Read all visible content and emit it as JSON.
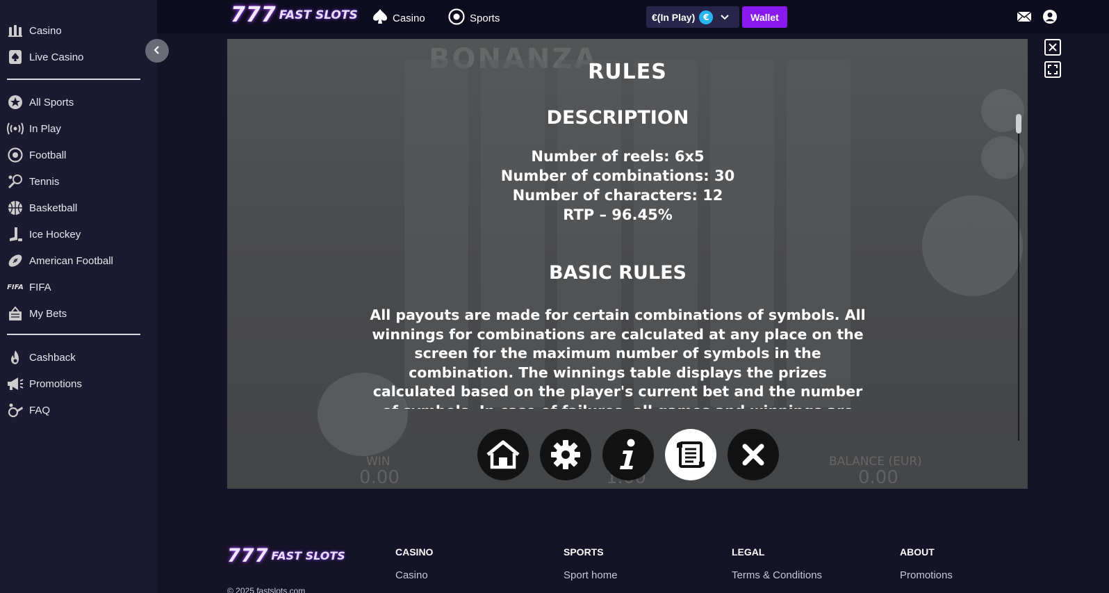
{
  "sidebar": {
    "items": [
      {
        "label": "Casino",
        "icon": "casino-icon"
      },
      {
        "label": "Live Casino",
        "icon": "spade-icon"
      },
      {
        "label": "All Sports",
        "icon": "star-icon"
      },
      {
        "label": "In Play",
        "icon": "broadcast-icon"
      },
      {
        "label": "Football",
        "icon": "football-icon"
      },
      {
        "label": "Tennis",
        "icon": "tennis-icon"
      },
      {
        "label": "Basketball",
        "icon": "basketball-icon"
      },
      {
        "label": "Ice Hockey",
        "icon": "hockey-icon"
      },
      {
        "label": "American Football",
        "icon": "american-football-icon"
      },
      {
        "label": "FIFA",
        "icon": "fifa-icon"
      },
      {
        "label": "My Bets",
        "icon": "bets-icon"
      },
      {
        "label": "Cashback",
        "icon": "flame-icon"
      },
      {
        "label": "Promotions",
        "icon": "megaphone-icon"
      },
      {
        "label": "FAQ",
        "icon": "faq-icon"
      }
    ],
    "fifa_glyph": "FIFA"
  },
  "header": {
    "logo_777": "777",
    "logo_text": "FAST SLOTS",
    "nav": [
      {
        "label": "Casino",
        "icon": "spade-icon"
      },
      {
        "label": "Sports",
        "icon": "football-icon"
      }
    ],
    "balance_label": "€(In Play)",
    "currency_symbol": "€",
    "wallet_label": "Wallet"
  },
  "game": {
    "ghost_logo": "BONANZA",
    "rules_title": "RULES",
    "description_title": "DESCRIPTION",
    "description_lines": [
      "Number of reels: 6x5",
      "Number of combinations: 30",
      "Number of characters: 12",
      "RTP – 96.45%"
    ],
    "basic_rules_title": "BASIC RULES",
    "basic_rules_text": "All payouts are made for certain combinations of symbols. All winnings for combinations are calculated at any place on the screen for the maximum number of symbols in the combination. The winnings table displays the prizes calculated based on the player's current bet and the number of symbols. In case of failures, all games and winnings are canceled.",
    "controls": [
      {
        "name": "home-button",
        "icon": "home-icon",
        "active": false
      },
      {
        "name": "settings-button",
        "icon": "gear-icon",
        "active": false
      },
      {
        "name": "info-button",
        "icon": "info-icon",
        "active": false
      },
      {
        "name": "rules-button",
        "icon": "scroll-icon",
        "active": true
      },
      {
        "name": "close-button",
        "icon": "close-icon",
        "active": false
      }
    ],
    "ghost_win_label": "WIN",
    "ghost_win_value": "0.00",
    "ghost_bet_value": "1.00",
    "ghost_balance_label": "BALANCE (EUR)",
    "ghost_balance_value": "0.00"
  },
  "footer": {
    "columns": [
      {
        "head": "CASINO",
        "link": "Casino"
      },
      {
        "head": "SPORTS",
        "link": "Sport home"
      },
      {
        "head": "LEGAL",
        "link": "Terms & Conditions"
      },
      {
        "head": "ABOUT",
        "link": "Promotions"
      }
    ],
    "copyright": "© 2025 fastslots.com"
  },
  "colors": {
    "accent": "#8a19f0",
    "sidebar_bg": "#1b1a31",
    "header_bg": "#0e0d20",
    "page_bg": "#141327",
    "euro_badge": "#29b6f0"
  }
}
